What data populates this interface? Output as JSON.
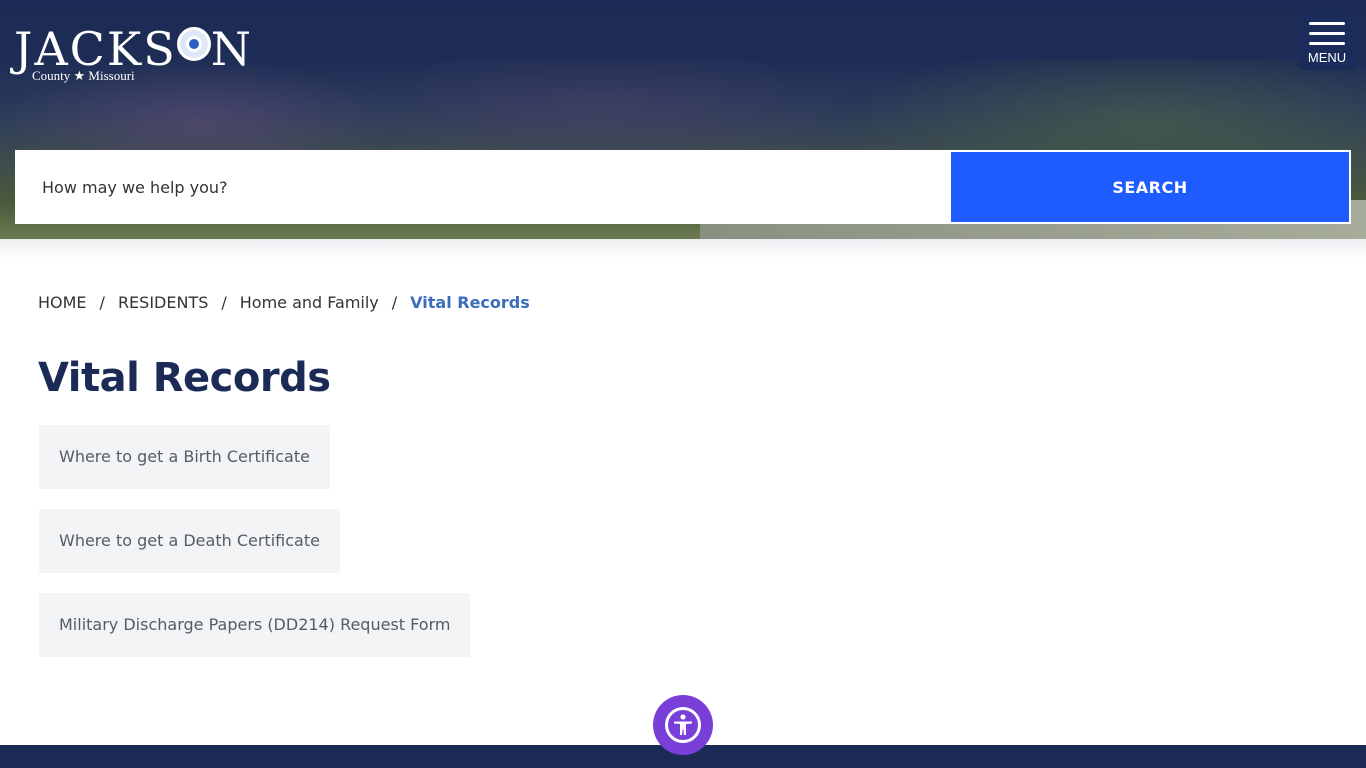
{
  "header": {
    "logo_main": "JACKSON",
    "logo_sub": "County ★ Missouri",
    "menu_label": "MENU"
  },
  "search": {
    "placeholder": "How may we help you?",
    "button_label": "SEARCH"
  },
  "breadcrumb": [
    {
      "label": "HOME"
    },
    {
      "label": "RESIDENTS"
    },
    {
      "label": "Home and Family"
    },
    {
      "label": "Vital Records"
    }
  ],
  "page": {
    "title": "Vital Records",
    "links": [
      {
        "label": "Where to get a Birth Certificate"
      },
      {
        "label": "Where to get a Death Certificate"
      },
      {
        "label": "Military Discharge Papers (DD214) Request Form"
      }
    ]
  },
  "colors": {
    "navy": "#1c2b55",
    "search_button": "#1f5cff",
    "breadcrumb_current": "#3b6dbc",
    "accessibility": "#7a3fd9"
  },
  "icons": {
    "menu": "hamburger-icon",
    "accessibility": "accessibility-person-icon"
  }
}
